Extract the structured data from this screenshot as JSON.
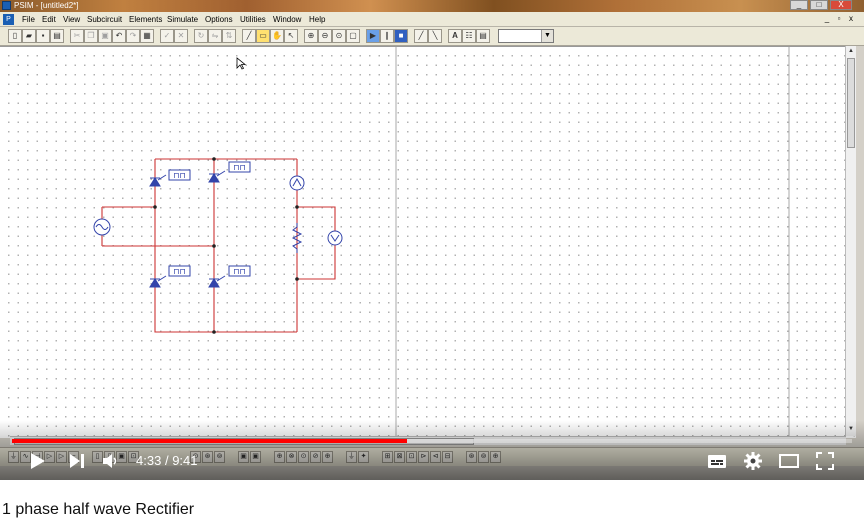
{
  "window": {
    "title": "PSIM - [untitled2*]",
    "minimize": "_",
    "restore": "□",
    "close": "X",
    "app_icon": "P"
  },
  "menu": {
    "items": [
      "File",
      "Edit",
      "View",
      "Subcircuit",
      "Elements",
      "Simulate",
      "Options",
      "Utilities",
      "Window",
      "Help"
    ],
    "mdi_minimize": "_",
    "mdi_restore": "▫",
    "mdi_close": "x"
  },
  "toolbar": {
    "buttons": [
      "new-icon",
      "open-icon",
      "save-icon",
      "print-icon",
      "cut-icon",
      "copy-icon",
      "paste-icon",
      "undo-icon",
      "redo-icon",
      "clipboard-icon",
      "check-icon",
      "x-icon",
      "rotate-icon",
      "flip-h-icon",
      "flip-v-icon",
      "wire-icon",
      "label-icon",
      "hand-icon",
      "pointer-icon",
      "zoom-in-icon",
      "zoom-out-icon",
      "zoom-fit-icon",
      "zoom-page-icon",
      "run-icon",
      "pause-icon",
      "stop-icon",
      "probe-v-icon",
      "probe-i-icon",
      "text-icon",
      "element-list-icon",
      "library-icon"
    ],
    "zoom_value": ""
  },
  "circuit": {
    "thyristor_labels": [
      "⊓⊓",
      "⊓⊓",
      "⊓⊓",
      "⊓⊓"
    ]
  },
  "player": {
    "current_time": "4:33",
    "separator": "/",
    "duration": "9:41",
    "progress_fraction": 0.47,
    "loaded_fraction": 0.55,
    "colors": {
      "played": "#ff0000",
      "wire": "#cc3333",
      "component": "#3344aa"
    }
  },
  "video": {
    "title": "1 phase half wave Rectifier"
  }
}
